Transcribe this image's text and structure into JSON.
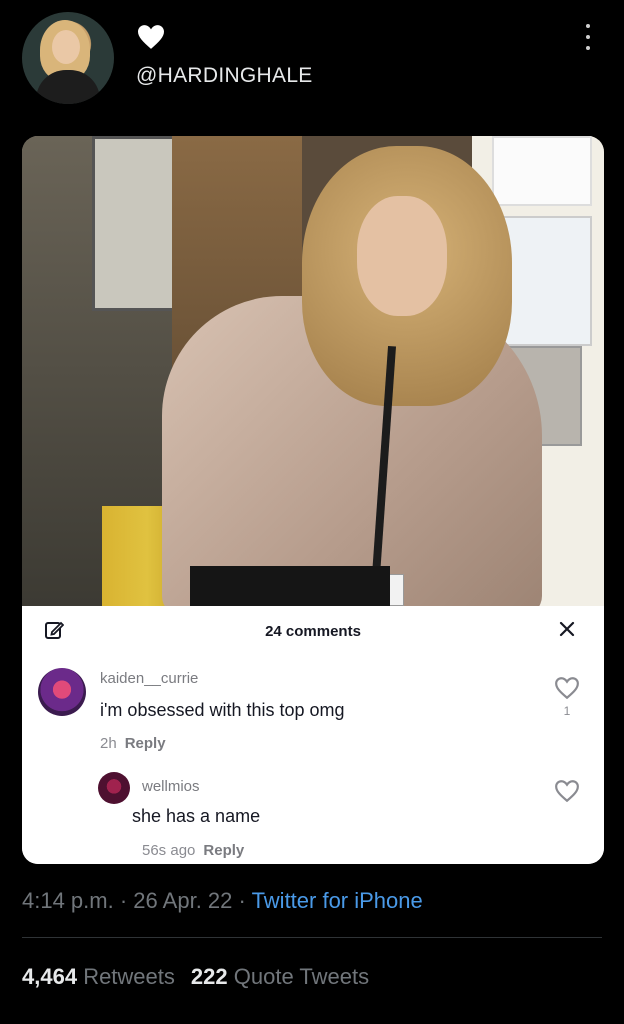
{
  "tweet": {
    "handle": "@HARDINGHALE",
    "time": "4:14 p.m.",
    "sep1": "·",
    "date": "26 Apr. 22",
    "sep2": "·",
    "source": "Twitter for iPhone",
    "retweets_count": "4,464",
    "retweets_label": "Retweets",
    "quotes_count": "222",
    "quotes_label": "Quote Tweets"
  },
  "comments_panel": {
    "title": "24 comments",
    "comments": [
      {
        "user": "kaiden__currie",
        "text": "i'm obsessed with this top omg",
        "age": "2h",
        "reply_label": "Reply",
        "likes": "1"
      },
      {
        "user": "wellmios",
        "text": "she has a name",
        "age": "56s ago",
        "reply_label": "Reply"
      }
    ]
  },
  "icons": {
    "heart": "heart-icon",
    "more": "more-icon",
    "edit": "edit-icon",
    "close": "close-icon",
    "like": "heart-outline-icon"
  },
  "colors": {
    "background": "#000000",
    "link": "#4a9ae8",
    "muted": "#71767b"
  }
}
